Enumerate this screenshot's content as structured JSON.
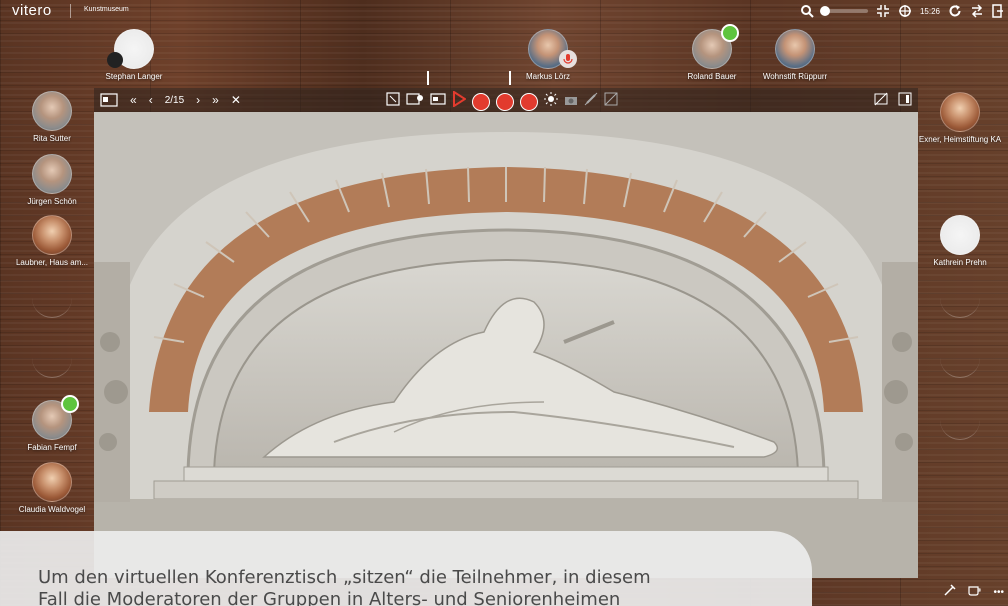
{
  "app": {
    "logo": "vitero",
    "room": "Kunstmuseum"
  },
  "topbar": {
    "time": "15:26"
  },
  "participants": {
    "top": [
      {
        "name": "Stephan Langer"
      },
      {
        "name": "Markus Lörz"
      },
      {
        "name": "Roland Bauer"
      },
      {
        "name": "Wohnstift Rüppurr"
      }
    ],
    "left": [
      {
        "name": "Rita Sutter"
      },
      {
        "name": "Jürgen Schön"
      },
      {
        "name": "Laubner, Haus am..."
      },
      {
        "name": "Fabian Fempf"
      },
      {
        "name": "Claudia Waldvogel"
      }
    ],
    "right": [
      {
        "name": "Exner, Heimstiftung KA"
      },
      {
        "name": "Kathrein Prehn"
      }
    ]
  },
  "presentation": {
    "page": "2/15"
  },
  "caption": {
    "line1": "Um den virtuellen Konferenztisch „sitzen“ die Teilnehmer, in diesem",
    "line2": "Fall die Moderatoren der Gruppen in Alters- und Seniorenheimen"
  }
}
